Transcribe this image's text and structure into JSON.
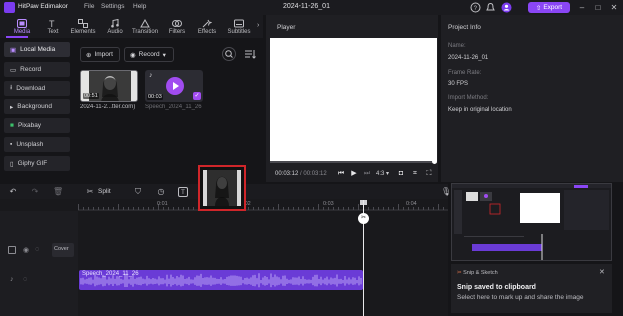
{
  "app": {
    "name": "HitPaw Edimakor",
    "menu": [
      "File",
      "Settings",
      "Help"
    ],
    "project_title": "2024-11-26_01",
    "export_label": "Export",
    "accent": "#8a46f5"
  },
  "media_tabs": [
    {
      "label": "Media",
      "icon": "media-icon",
      "active": true
    },
    {
      "label": "Text",
      "icon": "text-icon"
    },
    {
      "label": "Elements",
      "icon": "elements-icon"
    },
    {
      "label": "Audio",
      "icon": "audio-icon"
    },
    {
      "label": "Transition",
      "icon": "transition-icon"
    },
    {
      "label": "Filters",
      "icon": "filters-icon"
    },
    {
      "label": "Effects",
      "icon": "effects-icon"
    },
    {
      "label": "Subtitles",
      "icon": "subtitles-icon"
    }
  ],
  "left_nav": [
    {
      "label": "Local Media",
      "active": true
    },
    {
      "label": "Record"
    },
    {
      "label": "Download"
    },
    {
      "label": "Background"
    },
    {
      "label": "Pixabay"
    },
    {
      "label": "Unsplash"
    },
    {
      "label": "Giphy GIF"
    }
  ],
  "media_toolbar": {
    "import_label": "Import",
    "record_label": "Record"
  },
  "media_items": [
    {
      "name": "2024-11-2...tter.com)",
      "duration": "00:51"
    },
    {
      "name": "Speech_2024_11_26",
      "duration": "00:03"
    }
  ],
  "player": {
    "title": "Player",
    "current_time": "00:03:12",
    "total_time": "00:03:12",
    "ratio": "4:3"
  },
  "project_info": {
    "title": "Project Info",
    "fields": [
      {
        "label": "Name:",
        "value": "2024-11-26_01"
      },
      {
        "label": "Frame Rate:",
        "value": "30 FPS"
      },
      {
        "label": "Import Method:",
        "value": "Keep in original location"
      }
    ]
  },
  "timeline": {
    "split_label": "Split",
    "ticks": [
      "0:01",
      "0:02",
      "0:03",
      "0:04"
    ],
    "cover_label": "Cover",
    "audio_clip_label": "Speech_2024_11_26"
  },
  "toast": {
    "app": "Snip & Sketch",
    "title": "Snip saved to clipboard",
    "body": "Select here to mark up and share the image"
  }
}
